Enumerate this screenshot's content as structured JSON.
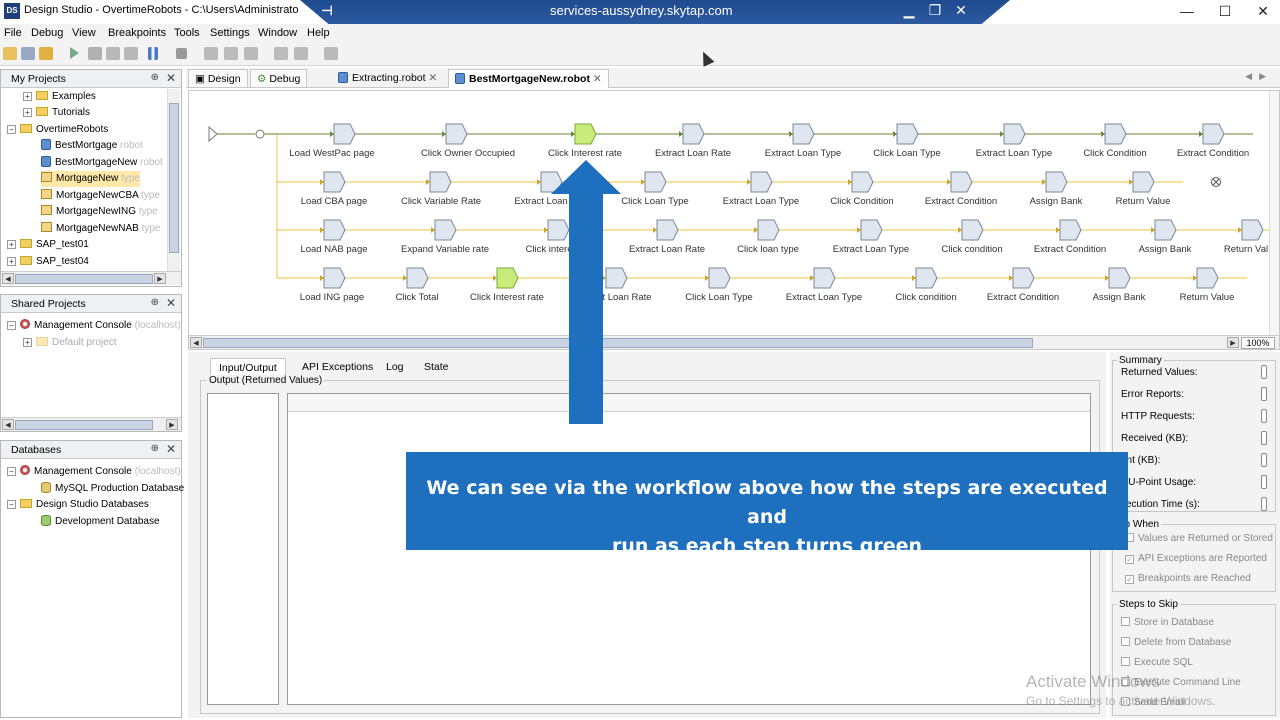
{
  "window": {
    "title": "Design Studio - OvertimeRobots - C:\\Users\\Administrato",
    "remote_host": "services-aussydney.skytap.com",
    "minimize": "—",
    "maximize": "☐",
    "close": "✕"
  },
  "menu": [
    "File",
    "Debug",
    "View",
    "Breakpoints",
    "Tools",
    "Settings",
    "Window",
    "Help"
  ],
  "my_projects": {
    "title": "My Projects",
    "items": [
      {
        "label": "Examples",
        "hint": ""
      },
      {
        "label": "Tutorials",
        "hint": ""
      },
      {
        "label": "OvertimeRobots",
        "hint": ""
      },
      {
        "label": "BestMortgage",
        "hint": "robot"
      },
      {
        "label": "BestMortgageNew",
        "hint": "robot"
      },
      {
        "label": "MortgageNew",
        "hint": "type"
      },
      {
        "label": "MortgageNewCBA",
        "hint": "type"
      },
      {
        "label": "MortgageNewING",
        "hint": "type"
      },
      {
        "label": "MortgageNewNAB",
        "hint": "type"
      },
      {
        "label": "SAP_test01",
        "hint": ""
      },
      {
        "label": "SAP_test04",
        "hint": ""
      }
    ]
  },
  "shared_projects": {
    "title": "Shared Projects",
    "items": [
      {
        "label": "Management Console",
        "hint": "(localhost)"
      },
      {
        "label": "Default project",
        "hint": ""
      }
    ]
  },
  "databases": {
    "title": "Databases",
    "items": [
      {
        "label": "Management Console",
        "hint": "(localhost)"
      },
      {
        "label": "MySQL Production Database",
        "hint": ""
      },
      {
        "label": "Design Studio Databases",
        "hint": ""
      },
      {
        "label": "Development Database",
        "hint": ""
      }
    ]
  },
  "tabs": {
    "design": "Design",
    "debug": "Debug",
    "file1": "Extracting.robot",
    "file2": "BestMortgageNew.robot"
  },
  "workflow": {
    "rows": [
      [
        "Load WestPac page",
        "Click Owner Occupied",
        "Click Interest rate",
        "Extract Loan Rate",
        "Extract Loan Type",
        "Click Loan Type",
        "Extract Loan Type",
        "Click Condition",
        "Extract Condition"
      ],
      [
        "Load CBA page",
        "Click Variable Rate",
        "Extract Loan",
        "Click Loan Type",
        "Extract Loan Type",
        "Click Condition",
        "Extract Condition",
        "Assign Bank",
        "Return Value"
      ],
      [
        "Load NAB page",
        "Expand Variable rate",
        "Click intere",
        "Extract Loan Rate",
        "Click loan type",
        "Extract Loan Type",
        "Click condition",
        "Extract Condition",
        "Assign Bank",
        "Return Val"
      ],
      [
        "Load ING page",
        "Click Total",
        "Click Interest rate",
        "t Loan Rate",
        "Click Loan Type",
        "Extract Loan Type",
        "Click condition",
        "Extract Condition",
        "Assign Bank",
        "Return Value"
      ]
    ],
    "active_step": "Click Interest rate",
    "zoom": "100%"
  },
  "bottom_tabs": [
    "Input/Output",
    "API Exceptions",
    "Log",
    "State"
  ],
  "output_label": "Output (Returned Values)",
  "summary": {
    "title": "Summary",
    "rows": [
      "Returned Values:",
      "Error Reports:",
      "HTTP Requests:",
      "Received (KB):",
      "ent (KB):",
      "CU-Point Usage:",
      "xecution Time (s):"
    ]
  },
  "stop_when": {
    "title": "op When",
    "items": [
      {
        "label": "Values are Returned or Stored",
        "checked": false
      },
      {
        "label": "API Exceptions are Reported",
        "checked": true
      },
      {
        "label": "Breakpoints are Reached",
        "checked": true
      }
    ]
  },
  "steps_to_skip": {
    "title": "Steps to Skip",
    "items": [
      "Store in Database",
      "Delete from Database",
      "Execute SQL",
      "Execute Command Line",
      "Send Email"
    ]
  },
  "callout": {
    "line1": "We can see via the workflow above how the steps are executed and",
    "line2": "run as each step turns green"
  },
  "watermark": {
    "line1": "Activate Windows",
    "line2": "Go to Settings to activate Windows."
  },
  "colors": {
    "accent_blue": "#1f6fbf",
    "active_step_green": "#c8ec7a",
    "connector_yellow": "#f0d060"
  }
}
